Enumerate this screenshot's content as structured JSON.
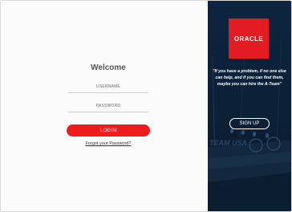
{
  "login": {
    "heading": "Welcome",
    "username_placeholder": "USERNAME",
    "password_placeholder": "PASSWORD",
    "login_button": "LOGIN",
    "forgot_link": "Forgot your Password?"
  },
  "promo": {
    "logo_text": "ORACLE",
    "quote": "\"If you have a problem, if no one else can help, and if you can find them, maybe you can hire the A-Team\"",
    "signup_button": "SIGN UP",
    "colors": {
      "brand_red": "#e31b23",
      "button_red": "#ee1c1c",
      "panel_navy": "#0e2541"
    }
  }
}
